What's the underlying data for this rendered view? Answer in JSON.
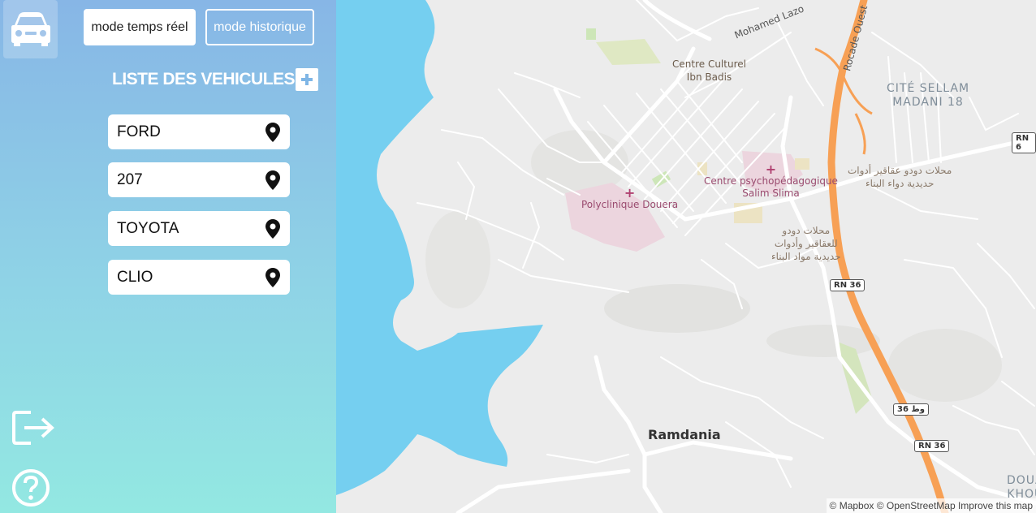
{
  "sidebar": {
    "mode_realtime": "mode temps réel",
    "mode_historic": "mode historique",
    "list_title": "LISTE DES VEHICULES",
    "add_symbol": "+",
    "vehicles": [
      {
        "label": "FORD"
      },
      {
        "label": "207"
      },
      {
        "label": "TOYOTA"
      },
      {
        "label": "CLIO"
      }
    ]
  },
  "icons": {
    "car": "car-icon",
    "add": "plus-icon",
    "marker": "map-marker-icon",
    "logout": "logout-icon",
    "help": "help-icon"
  },
  "map": {
    "labels": {
      "ramdania": "Ramdania",
      "polyclinique": "Polyclinique Douera",
      "centre_psy_1": "Centre psychopédagogique",
      "centre_psy_2": "Salim Slima",
      "centre_culturel_1": "Centre Culturel",
      "centre_culturel_2": "Ibn Badis",
      "cite_1": "CITÉ SELLAM",
      "cite_2": "MADANI 18",
      "street_lazo": "Mohamed Lazo",
      "rocade": "Rocade Ouest",
      "arabic_1a": "محلات دودو عقاقير أدوات",
      "arabic_1b": "حديدية دواء البناء",
      "arabic_2a": "محلات دودو",
      "arabic_2b": "للعقاقير وأدوات",
      "arabic_2c": "حديدية مواد البناء",
      "doua_1": "DOUA",
      "doua_2": "KHOU"
    },
    "shields": {
      "rn36_a": "RN 36",
      "rn36_b": "36 وط",
      "rn36_c": "RN 36",
      "rn6": "RN 6"
    },
    "attribution": "© Mapbox © OpenStreetMap Improve this map"
  },
  "colors": {
    "sidebar_top": "#87b6e6",
    "sidebar_bottom": "#93e8e2",
    "water": "#75cff0",
    "highway": "#f7a055",
    "map_bg": "#ececec"
  }
}
